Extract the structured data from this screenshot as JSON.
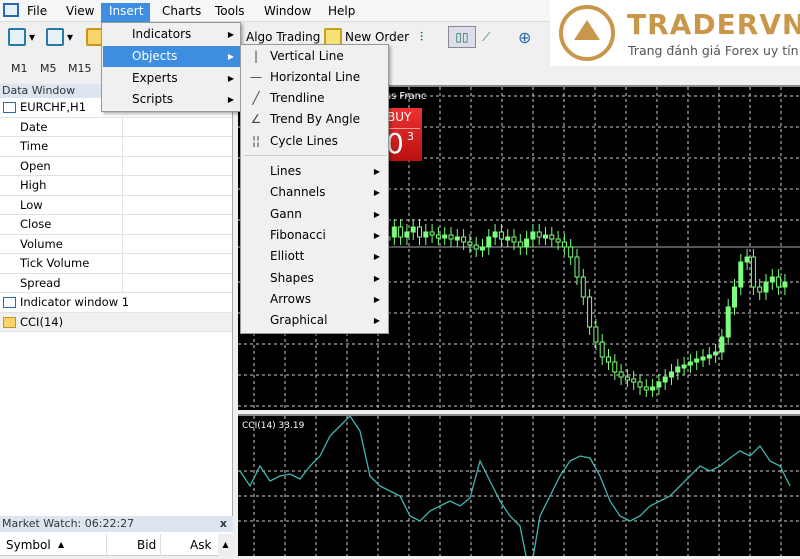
{
  "menubar": {
    "items": [
      "File",
      "View",
      "Insert",
      "Charts",
      "Tools",
      "Window",
      "Help"
    ],
    "active": "Insert"
  },
  "toolbar": {
    "algo_trading": "Algo Trading",
    "new_order": "New Order"
  },
  "timeframes": [
    "M1",
    "M5",
    "M15"
  ],
  "data_window": {
    "title": "Data Window",
    "symbol": "EURCHF,H1",
    "fields": [
      "Date",
      "Time",
      "Open",
      "High",
      "Low",
      "Close",
      "Volume",
      "Tick Volume",
      "Spread"
    ],
    "indicator_window": "Indicator window 1",
    "indicator": "CCI(14)"
  },
  "market_watch": {
    "title": "Market Watch: 06:22:27",
    "close": "x",
    "columns": [
      "Symbol",
      "Bid",
      "Ask"
    ]
  },
  "chart": {
    "symbol_label": "iss Franc",
    "buy_label": "BUY",
    "buy_price_big": "0",
    "buy_price_sup": "3",
    "cci_label": "CCI(14) 33.19"
  },
  "insert_menu": {
    "items": [
      "Indicators",
      "Objects",
      "Experts",
      "Scripts"
    ],
    "highlighted": "Objects"
  },
  "objects_menu": {
    "items": [
      {
        "label": "Vertical Line",
        "icon": "vertical-line-icon"
      },
      {
        "label": "Horizontal Line",
        "icon": "horizontal-line-icon"
      },
      {
        "label": "Trendline",
        "icon": "trendline-icon"
      },
      {
        "label": "Trend By Angle",
        "icon": "trend-angle-icon"
      },
      {
        "label": "Cycle Lines",
        "icon": "cycle-lines-icon"
      }
    ],
    "submenus": [
      "Lines",
      "Channels",
      "Gann",
      "Fibonacci",
      "Elliott",
      "Shapes",
      "Arrows",
      "Graphical"
    ]
  },
  "logo": {
    "name": "TRADERVN",
    "tagline": "Trang đánh giá Forex uy tín"
  },
  "colors": {
    "menu_highlight": "#3d8ee0",
    "bull_candle": "#7cff7c",
    "cci_line": "#3fb5b0",
    "buy_button": "#d42020"
  }
}
